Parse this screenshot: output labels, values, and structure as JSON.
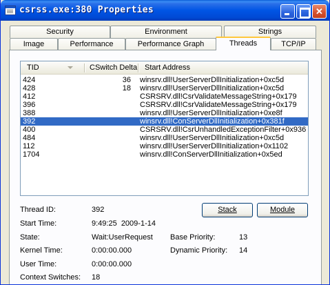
{
  "window": {
    "title": "csrss.exe:380 Properties"
  },
  "titlebar_buttons": {
    "minimize": "minimize-icon",
    "maximize": "maximize-icon",
    "close": "close-icon"
  },
  "tabs_row1": [
    "Security",
    "Environment",
    "Strings"
  ],
  "tabs_row2": [
    "Image",
    "Performance",
    "Performance Graph",
    "Threads",
    "TCP/IP"
  ],
  "active_tab": "Threads",
  "columns": {
    "tid": "TID",
    "cswitch": "CSwitch Delta",
    "start": "Start Address"
  },
  "threads": [
    {
      "tid": "424",
      "cswitch": "36",
      "start": "winsrv.dll!UserServerDllInitialization+0xc5d"
    },
    {
      "tid": "428",
      "cswitch": "18",
      "start": "winsrv.dll!UserServerDllInitialization+0xc5d"
    },
    {
      "tid": "412",
      "cswitch": "",
      "start": "CSRSRV.dll!CsrValidateMessageString+0x179"
    },
    {
      "tid": "396",
      "cswitch": "",
      "start": "CSRSRV.dll!CsrValidateMessageString+0x179"
    },
    {
      "tid": "388",
      "cswitch": "",
      "start": "winsrv.dll!UserServerDllInitialization+0xe8f"
    },
    {
      "tid": "392",
      "cswitch": "",
      "start": "winsrv.dll!ConServerDllInitialization+0x381f",
      "selected": true
    },
    {
      "tid": "400",
      "cswitch": "",
      "start": "CSRSRV.dll!CsrUnhandledExceptionFilter+0x936"
    },
    {
      "tid": "484",
      "cswitch": "",
      "start": "winsrv.dll!UserServerDllInitialization+0xc5d"
    },
    {
      "tid": "112",
      "cswitch": "",
      "start": "winsrv.dll!UserServerDllInitialization+0x1102"
    },
    {
      "tid": "1704",
      "cswitch": "",
      "start": "winsrv.dll!ConServerDllInitialization+0x5ed"
    }
  ],
  "details": {
    "thread_id_label": "Thread ID:",
    "thread_id": "392",
    "start_time_label": "Start Time:",
    "start_time": "9:49:25  2009-1-14",
    "state_label": "State:",
    "state": "Wait:UserRequest",
    "base_priority_label": "Base Priority:",
    "base_priority": "13",
    "kernel_time_label": "Kernel Time:",
    "kernel_time": "0:00:00.000",
    "dynamic_priority_label": "Dynamic Priority:",
    "dynamic_priority": "14",
    "user_time_label": "User Time:",
    "user_time": "0:00:00.000",
    "context_switches_label": "Context Switches:",
    "context_switches": "18"
  },
  "buttons": {
    "stack": "Stack",
    "module": "Module"
  }
}
